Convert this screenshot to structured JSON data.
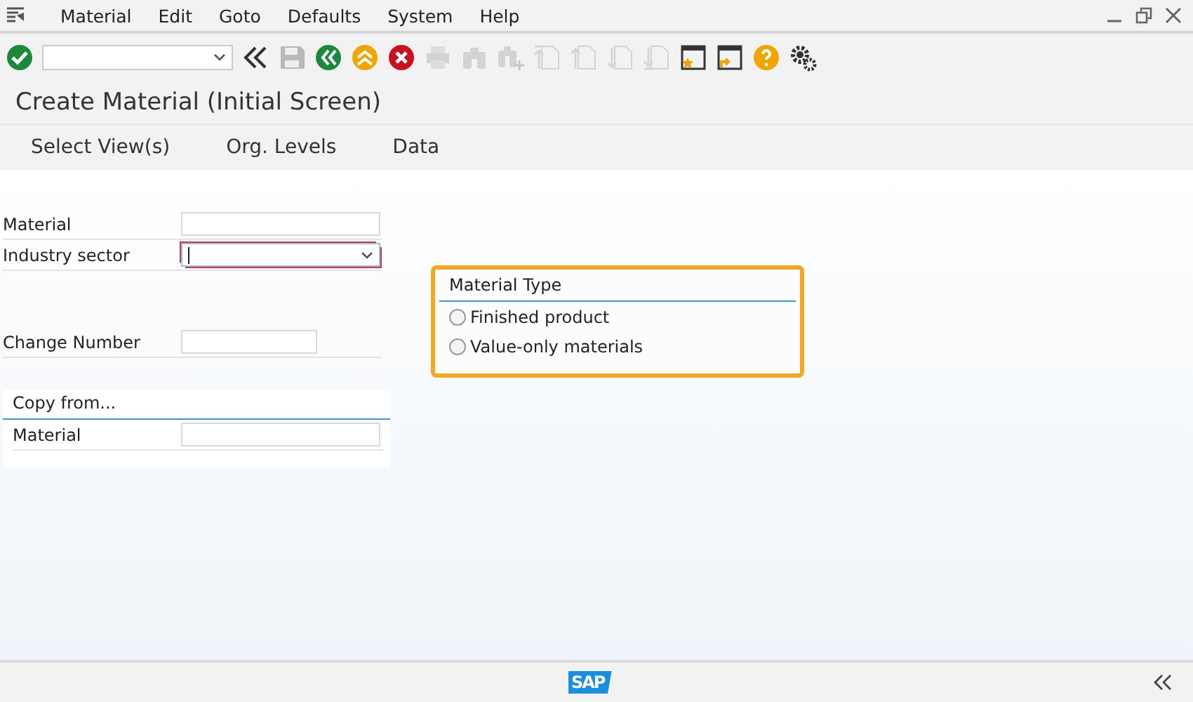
{
  "menu": [
    {
      "label": "Material"
    },
    {
      "label": "Edit"
    },
    {
      "label": "Goto"
    },
    {
      "label": "Defaults"
    },
    {
      "label": "System"
    },
    {
      "label": "Help"
    }
  ],
  "toolbar": [
    {
      "kind": "enter",
      "disabled": false
    },
    {
      "kind": "command-field"
    },
    {
      "kind": "collapse",
      "disabled": false
    },
    {
      "kind": "save",
      "disabled": true
    },
    {
      "kind": "back",
      "disabled": false
    },
    {
      "kind": "exit",
      "disabled": false
    },
    {
      "kind": "cancel",
      "disabled": false
    },
    {
      "kind": "print",
      "disabled": true
    },
    {
      "kind": "find",
      "disabled": true
    },
    {
      "kind": "find-next",
      "disabled": true
    },
    {
      "kind": "first-page",
      "disabled": true
    },
    {
      "kind": "prev-page",
      "disabled": true
    },
    {
      "kind": "next-page",
      "disabled": true
    },
    {
      "kind": "last-page",
      "disabled": true
    },
    {
      "kind": "new-session",
      "disabled": false
    },
    {
      "kind": "shortcut",
      "disabled": false
    },
    {
      "kind": "help",
      "disabled": false
    },
    {
      "kind": "settings",
      "disabled": false
    }
  ],
  "title": "Create Material (Initial Screen)",
  "app_toolbar": [
    {
      "label": "Select View(s)"
    },
    {
      "label": "Org. Levels"
    },
    {
      "label": "Data"
    }
  ],
  "fields": [
    {
      "label": "Material",
      "kind": "text",
      "focused": false
    },
    {
      "label": "Industry sector",
      "kind": "dropdown",
      "focused": true
    },
    {
      "kind": "gap"
    },
    {
      "label": "Change Number",
      "kind": "short",
      "focused": false
    }
  ],
  "copy_from": {
    "title": "Copy from...",
    "fields": [
      {
        "label": "Material"
      }
    ]
  },
  "material_type": {
    "title": "Material Type",
    "highlighted": true,
    "options": [
      {
        "label": "Finished product",
        "selected": false
      },
      {
        "label": "Value-only materials",
        "selected": false
      }
    ]
  },
  "footer": {
    "logo": "SAP"
  }
}
